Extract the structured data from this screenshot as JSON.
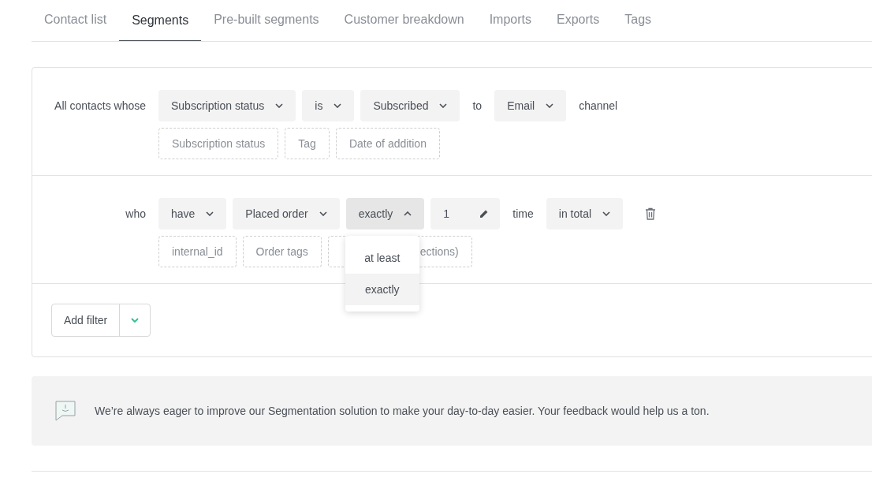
{
  "tabs": [
    {
      "label": "Contact list",
      "selected": false
    },
    {
      "label": "Segments",
      "selected": true
    },
    {
      "label": "Pre-built segments",
      "selected": false
    },
    {
      "label": "Customer breakdown",
      "selected": false
    },
    {
      "label": "Imports",
      "selected": false
    },
    {
      "label": "Exports",
      "selected": false
    },
    {
      "label": "Tags",
      "selected": false
    }
  ],
  "filters": [
    {
      "label": "All contacts whose",
      "items": [
        {
          "kind": "select",
          "text": "Subscription status",
          "open": false
        },
        {
          "kind": "select",
          "text": "is",
          "open": false
        },
        {
          "kind": "select",
          "text": "Subscribed",
          "open": false
        },
        {
          "kind": "word",
          "text": "to"
        },
        {
          "kind": "select",
          "text": "Email",
          "open": false
        },
        {
          "kind": "word",
          "text": "channel"
        }
      ],
      "suggestions": [
        {
          "parts": [
            "Subscription status"
          ]
        },
        {
          "parts": [
            "Tag"
          ]
        },
        {
          "parts": [
            "Date of addition"
          ]
        }
      ]
    },
    {
      "label": "who",
      "items": [
        {
          "kind": "select",
          "text": "have",
          "open": false
        },
        {
          "kind": "select",
          "text": "Placed order",
          "open": false
        },
        {
          "kind": "select",
          "text": "exactly",
          "open": true,
          "options": [
            {
              "label": "at least",
              "selected": false
            },
            {
              "label": "exactly",
              "selected": true
            }
          ]
        },
        {
          "kind": "number",
          "text": "1"
        },
        {
          "kind": "word",
          "text": "time"
        },
        {
          "kind": "select",
          "text": "in total",
          "open": false
        },
        {
          "kind": "delete"
        }
      ],
      "suggestions": [
        {
          "parts": [
            "internal_id"
          ]
        },
        {
          "parts": [
            "Order tags"
          ]
        },
        {
          "parts": [
            "ections)"
          ],
          "covered": true
        }
      ]
    }
  ],
  "add_filter": {
    "label": "Add filter"
  },
  "feedback": {
    "text": "We’re always eager to improve our Segmentation solution to make your day-to-day easier. Your feedback would help us a ton."
  }
}
